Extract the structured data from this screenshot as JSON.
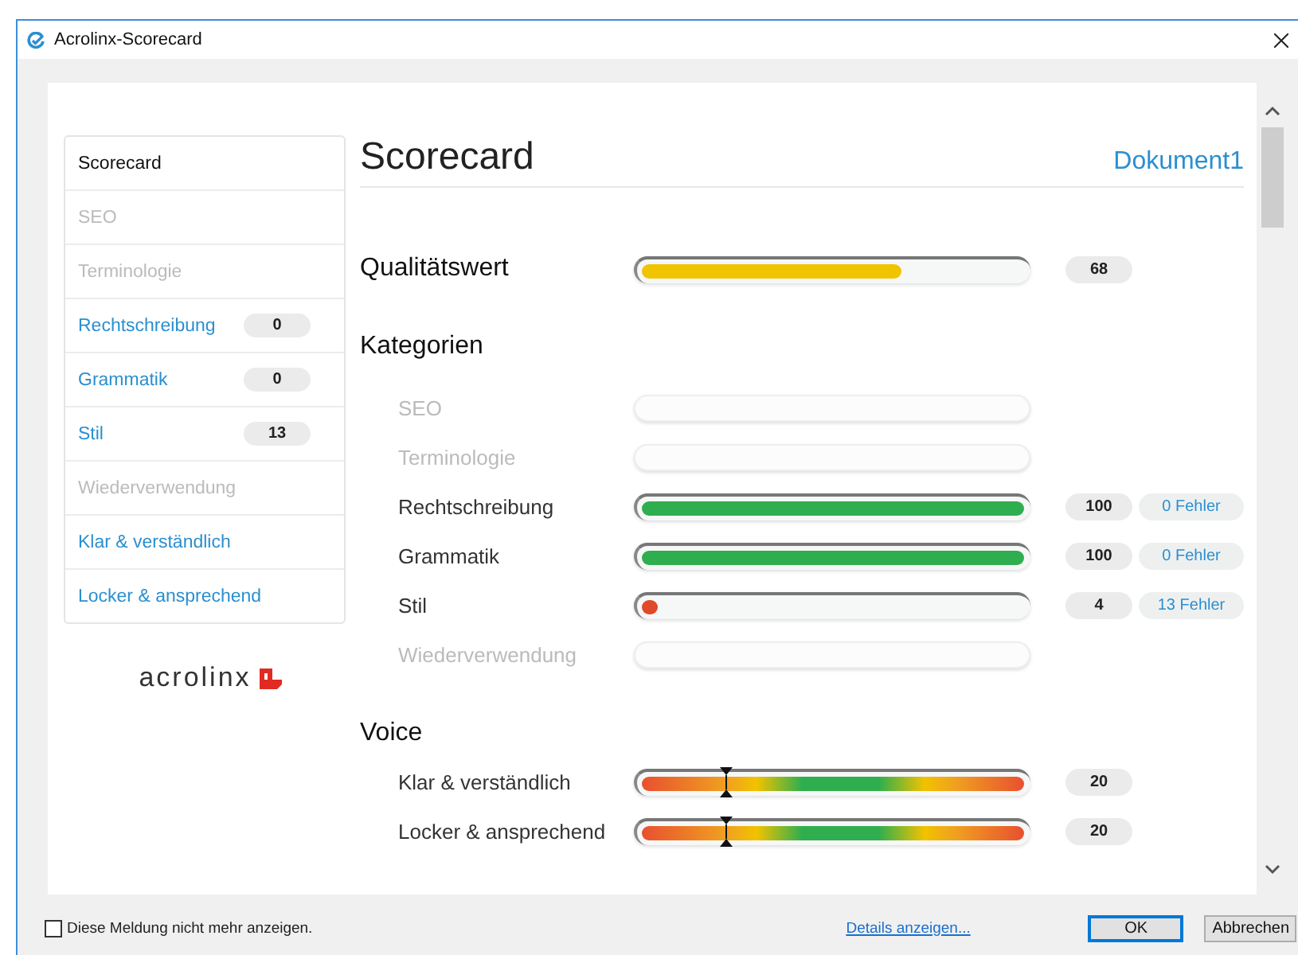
{
  "window": {
    "title": "Acrolinx-Scorecard"
  },
  "sidebar": {
    "items": [
      {
        "label": "Scorecard",
        "selected": true,
        "disabled": false
      },
      {
        "label": "SEO",
        "selected": false,
        "disabled": true
      },
      {
        "label": "Terminologie",
        "selected": false,
        "disabled": true
      },
      {
        "label": "Rechtschreibung",
        "selected": false,
        "disabled": false,
        "badge": "0"
      },
      {
        "label": "Grammatik",
        "selected": false,
        "disabled": false,
        "badge": "0"
      },
      {
        "label": "Stil",
        "selected": false,
        "disabled": false,
        "badge": "13"
      },
      {
        "label": "Wiederverwendung",
        "selected": false,
        "disabled": true
      },
      {
        "label": "Klar & verständlich",
        "selected": false,
        "disabled": false
      },
      {
        "label": "Locker & ansprechend",
        "selected": false,
        "disabled": false
      }
    ],
    "logo": "acrolinx"
  },
  "header": {
    "title": "Scorecard",
    "document": "Dokument1"
  },
  "quality": {
    "label": "Qualitätswert",
    "level": 0.68,
    "score": "68"
  },
  "categories": {
    "title": "Kategorien",
    "rows": [
      {
        "label": "SEO",
        "disabled": true
      },
      {
        "label": "Terminologie",
        "disabled": true
      },
      {
        "label": "Rechtschreibung",
        "disabled": false,
        "level": 1,
        "score": "100",
        "errors": "0 Fehler"
      },
      {
        "label": "Grammatik",
        "disabled": false,
        "level": 1,
        "score": "100",
        "errors": "0 Fehler"
      },
      {
        "label": "Stil",
        "disabled": false,
        "level": 0.04,
        "score": "4",
        "errors": "13 Fehler"
      },
      {
        "label": "Wiederverwendung",
        "disabled": true
      }
    ]
  },
  "voice": {
    "title": "Voice",
    "rows": [
      {
        "label": "Klar & verständlich",
        "level": 0.22,
        "score": "20"
      },
      {
        "label": "Locker & ansprechend",
        "level": 0.22,
        "score": "20"
      }
    ]
  },
  "footer": {
    "checkbox": {
      "label": "Diese Meldung nicht mehr anzeigen.",
      "checked": false
    },
    "link": "Details anzeigen...",
    "buttons": [
      "OK",
      "Abbrechen"
    ]
  }
}
